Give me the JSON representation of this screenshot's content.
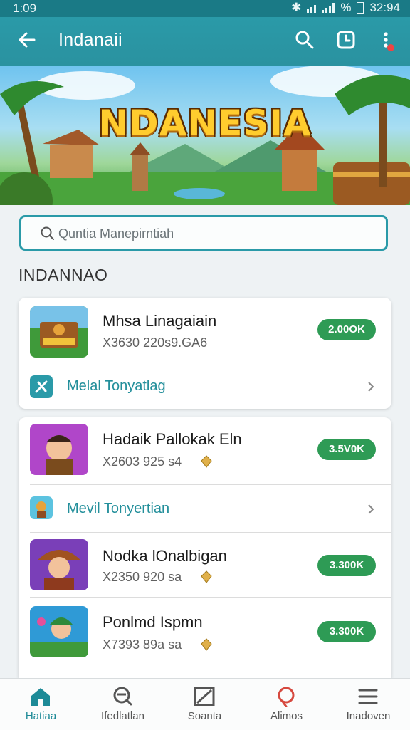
{
  "status_bar": {
    "time": "1:09",
    "battery_text": "%",
    "clock_right": "32:94"
  },
  "app_bar": {
    "title": "Indanaii"
  },
  "hero": {
    "title": "NDANESIA"
  },
  "search": {
    "placeholder": "Quntia Manepirntiah"
  },
  "section": {
    "title": "INDANNAO"
  },
  "cards": [
    {
      "items": [
        {
          "name": "Mhsa Linagaiain",
          "meta": "X3630 220s9.GA6",
          "price": "2.00OK"
        }
      ],
      "sub": {
        "label": "Melal Tonyatlag"
      }
    },
    {
      "items": [
        {
          "name": "Hadaik Pallokak Eln",
          "meta": "X2603 925 s4",
          "price": "3.5V0K"
        }
      ],
      "sub": {
        "label": "Mevil Tonyertian"
      },
      "more": [
        {
          "name": "Nodka lOnalbigan",
          "meta": "X2350 920 sa",
          "price": "3.300K"
        },
        {
          "name": "Ponlmd Ispmn",
          "meta": "X7393 89a sa",
          "price": "3.300K"
        }
      ]
    }
  ],
  "bottom_nav": [
    {
      "label": "Hatiaa",
      "icon": "home-icon",
      "active": true
    },
    {
      "label": "Ifedlatlan",
      "icon": "chat-search-icon",
      "active": false
    },
    {
      "label": "Soanta",
      "icon": "image-icon",
      "active": false
    },
    {
      "label": "Alimos",
      "icon": "pin-icon",
      "active": false
    },
    {
      "label": "Inadoven",
      "icon": "menu-icon",
      "active": false
    }
  ],
  "colors": {
    "primary": "#2a9aa8",
    "accent_green": "#2e9b55",
    "link": "#238f9b"
  }
}
